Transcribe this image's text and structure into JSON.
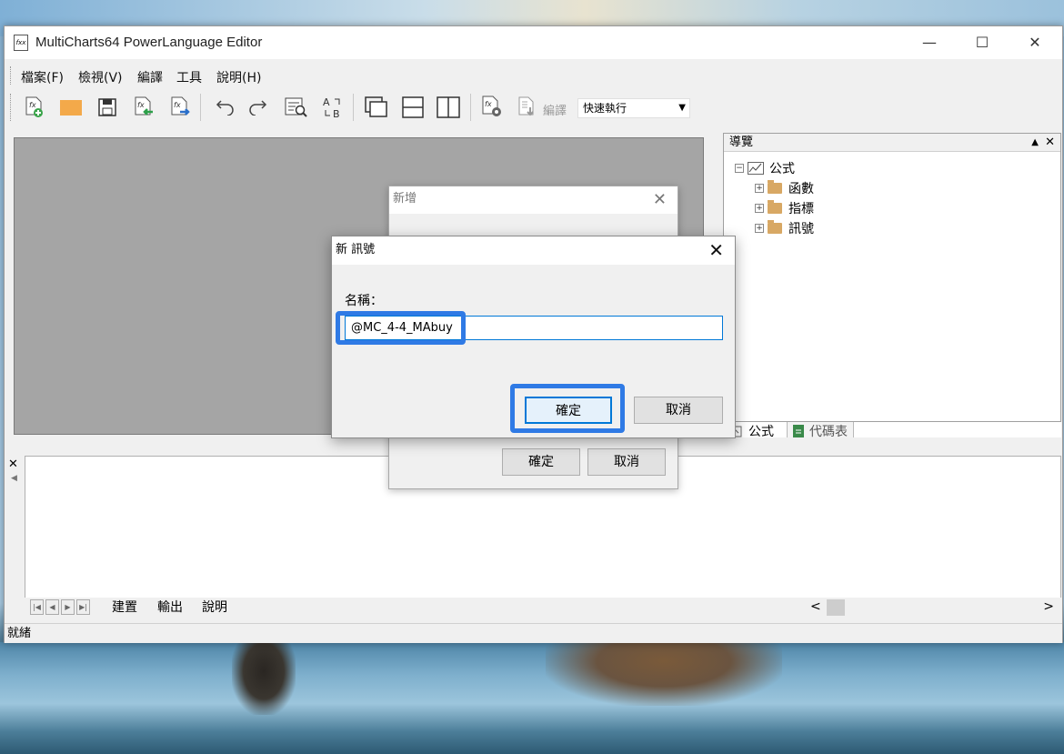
{
  "window": {
    "title": "MultiCharts64 PowerLanguage Editor",
    "icon_label": "fxx",
    "controls": {
      "minimize": "—",
      "maximize": "☐",
      "close": "✕"
    }
  },
  "menu": {
    "items": [
      "檔案(F)",
      "檢視(V)",
      "編譯",
      "工具",
      "說明(H)"
    ]
  },
  "toolbar": {
    "compile_label": "編譯",
    "mode_select": "快速執行",
    "mode_arrow": "▼"
  },
  "navigator": {
    "header": "導覽",
    "collapse": "▲",
    "close": "✕",
    "root": {
      "toggle": "−",
      "label": "公式"
    },
    "children": [
      {
        "toggle": "+",
        "label": "函數"
      },
      {
        "toggle": "+",
        "label": "指標"
      },
      {
        "toggle": "+",
        "label": "訊號"
      }
    ],
    "tabs": {
      "formula": "公式",
      "code_table": "代碼表"
    }
  },
  "output": {
    "close": "✕",
    "arrow": "◀",
    "nav_arrows": [
      "|◀",
      "◀",
      "▶",
      "▶|"
    ],
    "tabs": [
      "建置",
      "輸出",
      "說明"
    ],
    "scroll_left": "<",
    "scroll_right": ">"
  },
  "status": {
    "text": "就緒"
  },
  "dialog_back": {
    "title": "新增",
    "close": "✕",
    "ok": "確定",
    "cancel": "取消"
  },
  "dialog_front": {
    "title": "新 訊號",
    "close": "✕",
    "name_label": "名稱：",
    "name_value": "@MC_4-4_MAbuy",
    "ok": "確定",
    "cancel": "取消"
  },
  "colors": {
    "highlight": "#2f7ae5",
    "editor_bg": "#a5a5a5",
    "folder": "#d8a864"
  }
}
